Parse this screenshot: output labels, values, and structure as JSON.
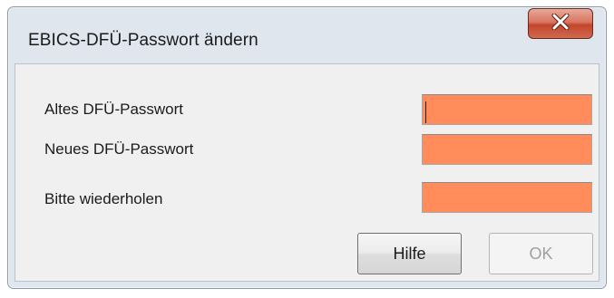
{
  "dialog": {
    "title": "EBICS-DFÜ-Passwort ändern",
    "close_icon": "close-icon"
  },
  "form": {
    "old_password": {
      "label": "Altes DFÜ-Passwort",
      "value": ""
    },
    "new_password": {
      "label": "Neues DFÜ-Passwort",
      "value": ""
    },
    "repeat_password": {
      "label": "Bitte wiederholen",
      "value": ""
    }
  },
  "buttons": {
    "help_label": "Hilfe",
    "ok_label": "OK",
    "ok_enabled": false
  },
  "colors": {
    "field_background": "#ff8c5a",
    "close_button": "#c4462c"
  }
}
